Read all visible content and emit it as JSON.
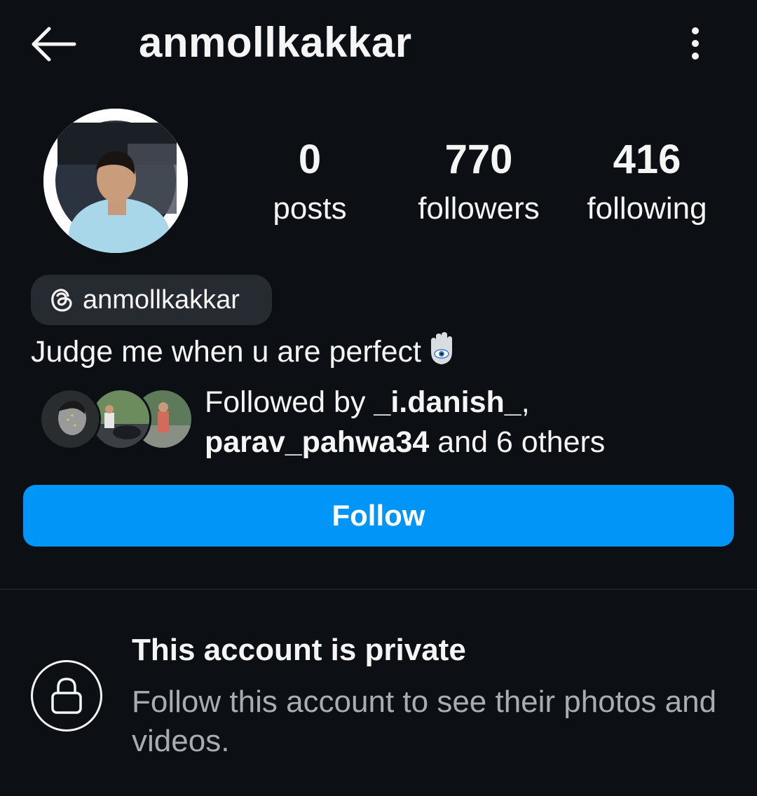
{
  "header": {
    "username": "anmollkakkar",
    "back_icon": "arrow-left-icon",
    "more_icon": "more-vertical-icon"
  },
  "stats": {
    "posts_count": "0",
    "posts_label": "posts",
    "followers_count": "770",
    "followers_label": "followers",
    "following_count": "416",
    "following_label": "following"
  },
  "threads": {
    "icon": "threads-icon",
    "handle": "anmollkakkar"
  },
  "bio": {
    "text": "Judge me when u are perfect",
    "emoji": "hamsa-icon"
  },
  "followed_by": {
    "prefix": "Followed by ",
    "user1": "_i.danish_",
    "separator": ",",
    "user2": "parav_pahwa34",
    "suffix": " and 6 others"
  },
  "actions": {
    "follow_label": "Follow"
  },
  "private_notice": {
    "icon": "lock-icon",
    "title": "This account is private",
    "subtitle": "Follow this account to see their photos and videos."
  },
  "colors": {
    "background": "#0c0f14",
    "accent": "#0095f6",
    "chip": "#262a31",
    "muted_text": "#a8acb3"
  }
}
